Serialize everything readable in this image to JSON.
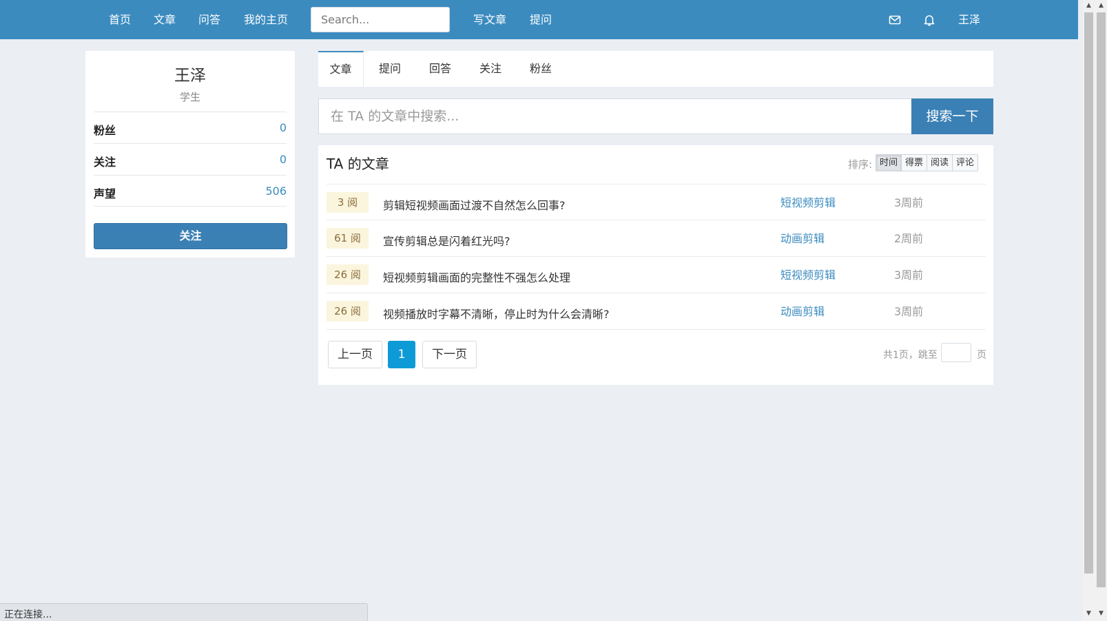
{
  "nav": {
    "home": "首页",
    "articles": "文章",
    "qa": "问答",
    "my_home": "我的主页",
    "search_placeholder": "Search...",
    "write_article": "写文章",
    "ask": "提问",
    "username": "王泽"
  },
  "profile": {
    "name": "王泽",
    "role": "学生",
    "stats": [
      {
        "label": "粉丝",
        "value": "0"
      },
      {
        "label": "关注",
        "value": "0"
      },
      {
        "label": "声望",
        "value": "506"
      }
    ],
    "follow_label": "关注"
  },
  "tabs": [
    {
      "label": "文章"
    },
    {
      "label": "提问"
    },
    {
      "label": "回答"
    },
    {
      "label": "关注"
    },
    {
      "label": "粉丝"
    }
  ],
  "article_search": {
    "placeholder": "在 TA 的文章中搜索...",
    "button": "搜索一下"
  },
  "articles_panel": {
    "title": "TA 的文章",
    "sort_label": "排序:",
    "sort_options": [
      "时间",
      "得票",
      "阅读",
      "评论"
    ],
    "rows": [
      {
        "views": "3 阅",
        "title": "剪辑短视频画面过渡不自然怎么回事?",
        "category": "短视频剪辑",
        "time": "3周前"
      },
      {
        "views": "61 阅",
        "title": "宣传剪辑总是闪着红光吗?",
        "category": "动画剪辑",
        "time": "2周前"
      },
      {
        "views": "26 阅",
        "title": "短视频剪辑画面的完整性不强怎么处理",
        "category": "短视频剪辑",
        "time": "3周前"
      },
      {
        "views": "26 阅",
        "title": "视频播放时字幕不清晰，停止时为什么会清晰?",
        "category": "动画剪辑",
        "time": "3周前"
      }
    ],
    "pagination": {
      "prev": "上一页",
      "current": "1",
      "next": "下一页",
      "info": "共1页，跳至",
      "unit": "页"
    }
  },
  "status_bar": "正在连接..."
}
